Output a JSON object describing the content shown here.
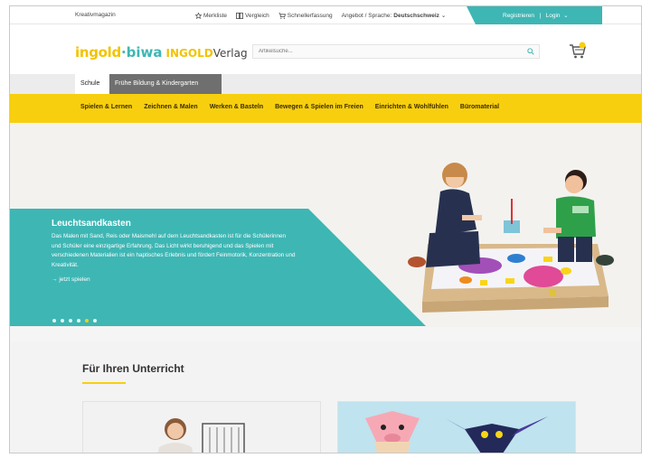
{
  "topbar": {
    "magazine": "Kreativmagazin",
    "links": [
      "Merkliste",
      "Vergleich",
      "Schnellerfassung"
    ],
    "offer_label": "Angebot / Sprache:",
    "offer_value": "Deutschschweiz",
    "register": "Registrieren",
    "separator": "|",
    "login": "Login"
  },
  "header": {
    "logo_part1": "ingold",
    "logo_dot": "·",
    "logo_part2": "biwa",
    "logo_part3": "INGOLD",
    "logo_part4": "Verlag",
    "search_placeholder": "Artikelsuche...",
    "cart_count": "0"
  },
  "tabs": [
    "Schule",
    "Frühe Bildung & Kindergarten"
  ],
  "nav": [
    "Spielen & Lernen",
    "Zeichnen & Malen",
    "Werken & Basteln",
    "Bewegen & Spielen im Freien",
    "Einrichten & Wohlfühlen",
    "Büromaterial"
  ],
  "hero": {
    "title": "Leuchtsandkasten",
    "text": "Das Malen mit Sand, Reis oder Maismehl auf dem Leuchtsandkasten ist für die Schülerinnen und Schüler eine einzigartige Erfahrung. Das Licht wirkt beruhigend und das Spielen mit verschiedenen Materialien ist ein haptisches Erlebnis und fördert Feinmotorik, Konzentration und Kreativität.",
    "cta": "jetzt spielen",
    "slides": 6,
    "active_slide": 5
  },
  "section": {
    "title": "Für Ihren Unterricht"
  },
  "colors": {
    "teal": "#3eb6b4",
    "yellow": "#f8cf0e",
    "dark_tab": "#6f6f6f"
  }
}
